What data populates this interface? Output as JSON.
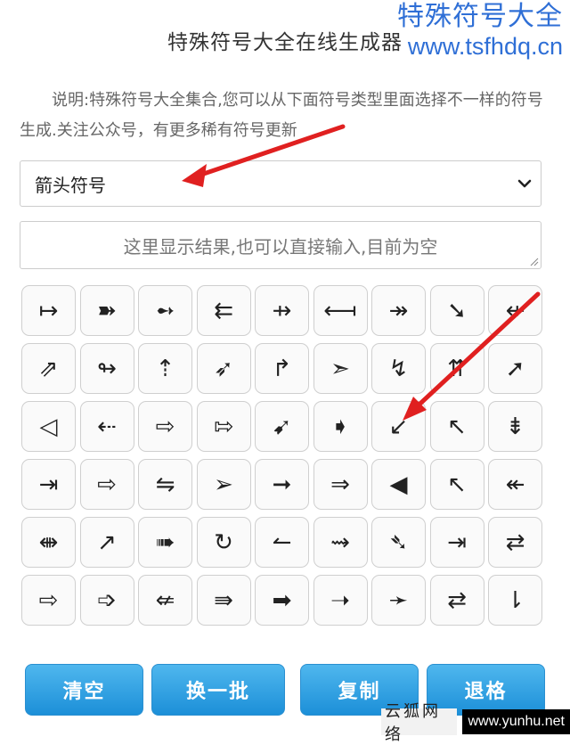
{
  "header": {
    "title": "特殊符号大全在线生成器",
    "watermark_line1": "特殊符号大全",
    "watermark_line2": "www.tsfhdq.cn"
  },
  "description": "说明:特殊符号大全集合,您可以从下面符号类型里面选择不一样的符号生成.关注公众号，有更多稀有符号更新",
  "category_select": {
    "selected": "箭头符号"
  },
  "result_box": {
    "placeholder": "这里显示结果,也可以直接输入,目前为空"
  },
  "symbols": [
    "↦",
    "➽",
    "➻",
    "⇇",
    "⇸",
    "⟻",
    "↠",
    "➘",
    "⇷",
    "⇗",
    "↬",
    "⇡",
    "➶",
    "↱",
    "➣",
    "↯",
    "⇈",
    "➚",
    "◁",
    "⇠",
    "⇨",
    "⇰",
    "➹",
    "➧",
    "↙",
    "↖",
    "⇟",
    "⇥",
    "⇨",
    "⇋",
    "➢",
    "➞",
    "⇒",
    "◀",
    "↖",
    "↞",
    "⇼",
    "↗",
    "➠",
    "↻",
    "↼",
    "⇝",
    "➴",
    "⇥",
    "⇄",
    "⇨",
    "➩",
    "⇍",
    "⇛",
    "➡",
    "➝",
    "➛",
    "⇄",
    "⇂"
  ],
  "buttons": {
    "clear": "清空",
    "next_batch": "换一批",
    "copy": "复制",
    "backspace": "退格"
  },
  "footer": {
    "brand": "云狐网络",
    "url": "www.yunhu.net"
  },
  "colors": {
    "accent": "#1c8fd8",
    "watermark": "#2f6fd6",
    "annotation_arrow": "#e02020"
  }
}
